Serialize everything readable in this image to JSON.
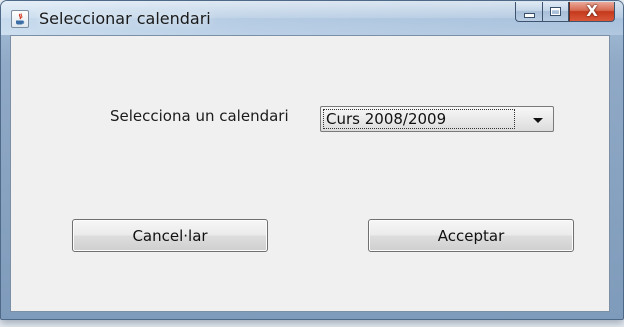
{
  "window": {
    "title": "Seleccionar calendari",
    "close_glyph": "X",
    "icons": {
      "app": "java-app-icon",
      "minimize": "minimize-icon",
      "maximize": "maximize-icon",
      "close": "close-icon"
    },
    "colors": {
      "frame": "#9fb8d3",
      "client_bg": "#f0f0f0",
      "close_button": "#c5391c"
    }
  },
  "form": {
    "calendar_label": "Selecciona un calendari",
    "calendar_select": {
      "selected": "Curs 2008/2009"
    }
  },
  "buttons": {
    "cancel": "Cancel·lar",
    "accept": "Acceptar"
  }
}
